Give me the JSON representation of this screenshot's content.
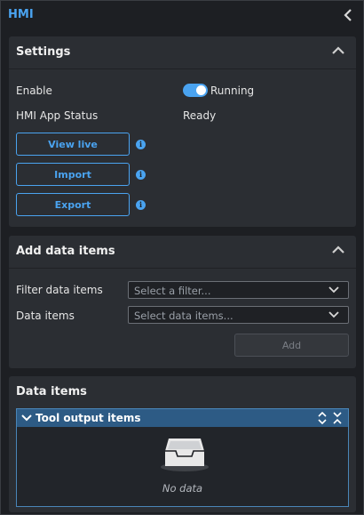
{
  "app": {
    "title": "HMI"
  },
  "settings": {
    "title": "Settings",
    "enable_label": "Enable",
    "enable_state": "Running",
    "status_label": "HMI App Status",
    "status_value": "Ready",
    "buttons": {
      "view_live": "View live",
      "import": "Import",
      "export": "Export"
    }
  },
  "add_items": {
    "title": "Add data items",
    "filter_label": "Filter data items",
    "filter_placeholder": "Select a filter...",
    "items_label": "Data items",
    "items_placeholder": "Select data items...",
    "add_label": "Add"
  },
  "data_items": {
    "title": "Data items",
    "group_title": "Tool output items",
    "empty_text": "No data"
  },
  "colors": {
    "accent": "#4aa3f0",
    "panel": "#2b2e33",
    "background": "#1d1f23",
    "group_header": "#2d5b85"
  }
}
